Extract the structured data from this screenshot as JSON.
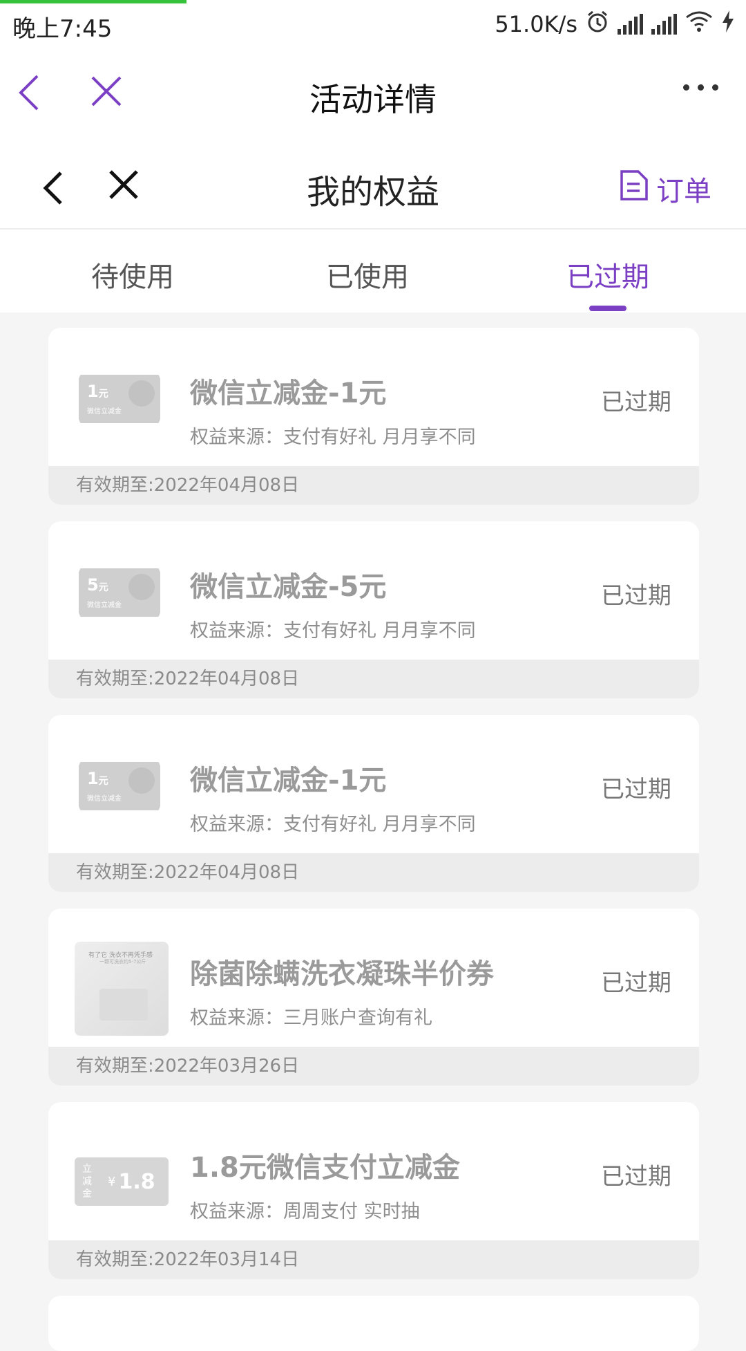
{
  "status_bar": {
    "time": "晚上7:45",
    "speed": "51.0K/s"
  },
  "header": {
    "title": "活动详情"
  },
  "subheader": {
    "title": "我的权益",
    "order_label": "订单"
  },
  "tabs": [
    {
      "label": "待使用",
      "active": false
    },
    {
      "label": "已使用",
      "active": false
    },
    {
      "label": "已过期",
      "active": true
    }
  ],
  "colors": {
    "accent": "#7b3fc4",
    "progress": "#36c23a"
  },
  "cards": [
    {
      "thumb_amount": "1",
      "thumb_unit": "元",
      "thumb_sub": "微信立减金",
      "title": "微信立减金-1元",
      "source": "权益来源：支付有好礼 月月享不同",
      "status": "已过期",
      "expiry": "有效期至:2022年04月08日"
    },
    {
      "thumb_amount": "5",
      "thumb_unit": "元",
      "thumb_sub": "微信立减金",
      "title": "微信立减金-5元",
      "source": "权益来源：支付有好礼 月月享不同",
      "status": "已过期",
      "expiry": "有效期至:2022年04月08日"
    },
    {
      "thumb_amount": "1",
      "thumb_unit": "元",
      "thumb_sub": "微信立减金",
      "title": "微信立减金-1元",
      "source": "权益来源：支付有好礼 月月享不同",
      "status": "已过期",
      "expiry": "有效期至:2022年04月08日"
    },
    {
      "thumb_line1": "有了它 洗衣不再凭手感",
      "thumb_line2": "一颗可洗衣约5-7公斤",
      "title": "除菌除螨洗衣凝珠半价券",
      "source": "权益来源：三月账户查询有礼",
      "status": "已过期",
      "expiry": "有效期至:2022年03月26日"
    },
    {
      "thumb_vertical": "立减金",
      "thumb_yen": "¥",
      "thumb_value": "1.8",
      "title": "1.8元微信支付立减金",
      "source": "权益来源：周周支付 实时抽",
      "status": "已过期",
      "expiry": "有效期至:2022年03月14日"
    }
  ]
}
